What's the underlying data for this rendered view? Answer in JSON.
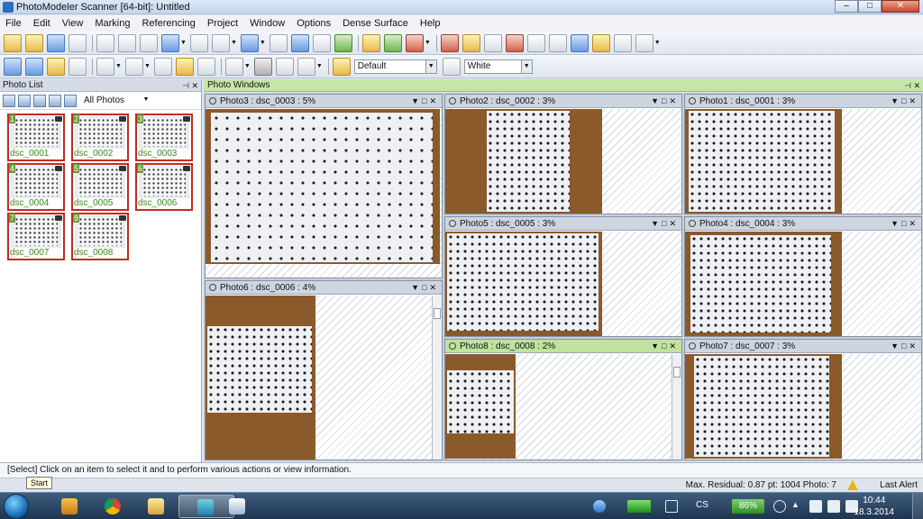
{
  "window": {
    "title": "PhotoModeler Scanner [64-bit]: Untitled",
    "min": "–",
    "max": "□",
    "close": "✕"
  },
  "menu": [
    "File",
    "Edit",
    "View",
    "Marking",
    "Referencing",
    "Project",
    "Window",
    "Options",
    "Dense Surface",
    "Help"
  ],
  "toolbar2": {
    "combo1": "Default",
    "combo2": "White"
  },
  "photo_list": {
    "title": "Photo List",
    "filter": "All Photos",
    "photos": [
      {
        "num": "1",
        "name": "dsc_0001"
      },
      {
        "num": "2",
        "name": "dsc_0002"
      },
      {
        "num": "3",
        "name": "dsc_0003"
      },
      {
        "num": "4",
        "name": "dsc_0004"
      },
      {
        "num": "5",
        "name": "dsc_0005"
      },
      {
        "num": "6",
        "name": "dsc_0006"
      },
      {
        "num": "7",
        "name": "dsc_0007"
      },
      {
        "num": "8",
        "name": "dsc_0008"
      }
    ]
  },
  "photo_windows": {
    "title": "Photo Windows",
    "windows": [
      {
        "title": "Photo3 : dsc_0003 : 5%"
      },
      {
        "title": "Photo2 : dsc_0002 : 3%"
      },
      {
        "title": "Photo1 : dsc_0001 : 3%"
      },
      {
        "title": "Photo5 : dsc_0005 : 3%"
      },
      {
        "title": "Photo4 : dsc_0004 : 3%"
      },
      {
        "title": "Photo6 : dsc_0006 : 4%"
      },
      {
        "title": "Photo8 : dsc_0008 : 2%"
      },
      {
        "title": "Photo7 : dsc_0007 : 3%"
      }
    ]
  },
  "status": {
    "message": "[Select] Click on an item to select it and to perform various actions or view information.",
    "residual": "Max. Residual: 0.87 pt: 1004 Photo: 7",
    "last_alert": "Last Alert",
    "tooltip": "Start"
  },
  "taskbar": {
    "lang": "CS",
    "battery": "86%",
    "time": "10:44",
    "date": "18.3.2014"
  }
}
